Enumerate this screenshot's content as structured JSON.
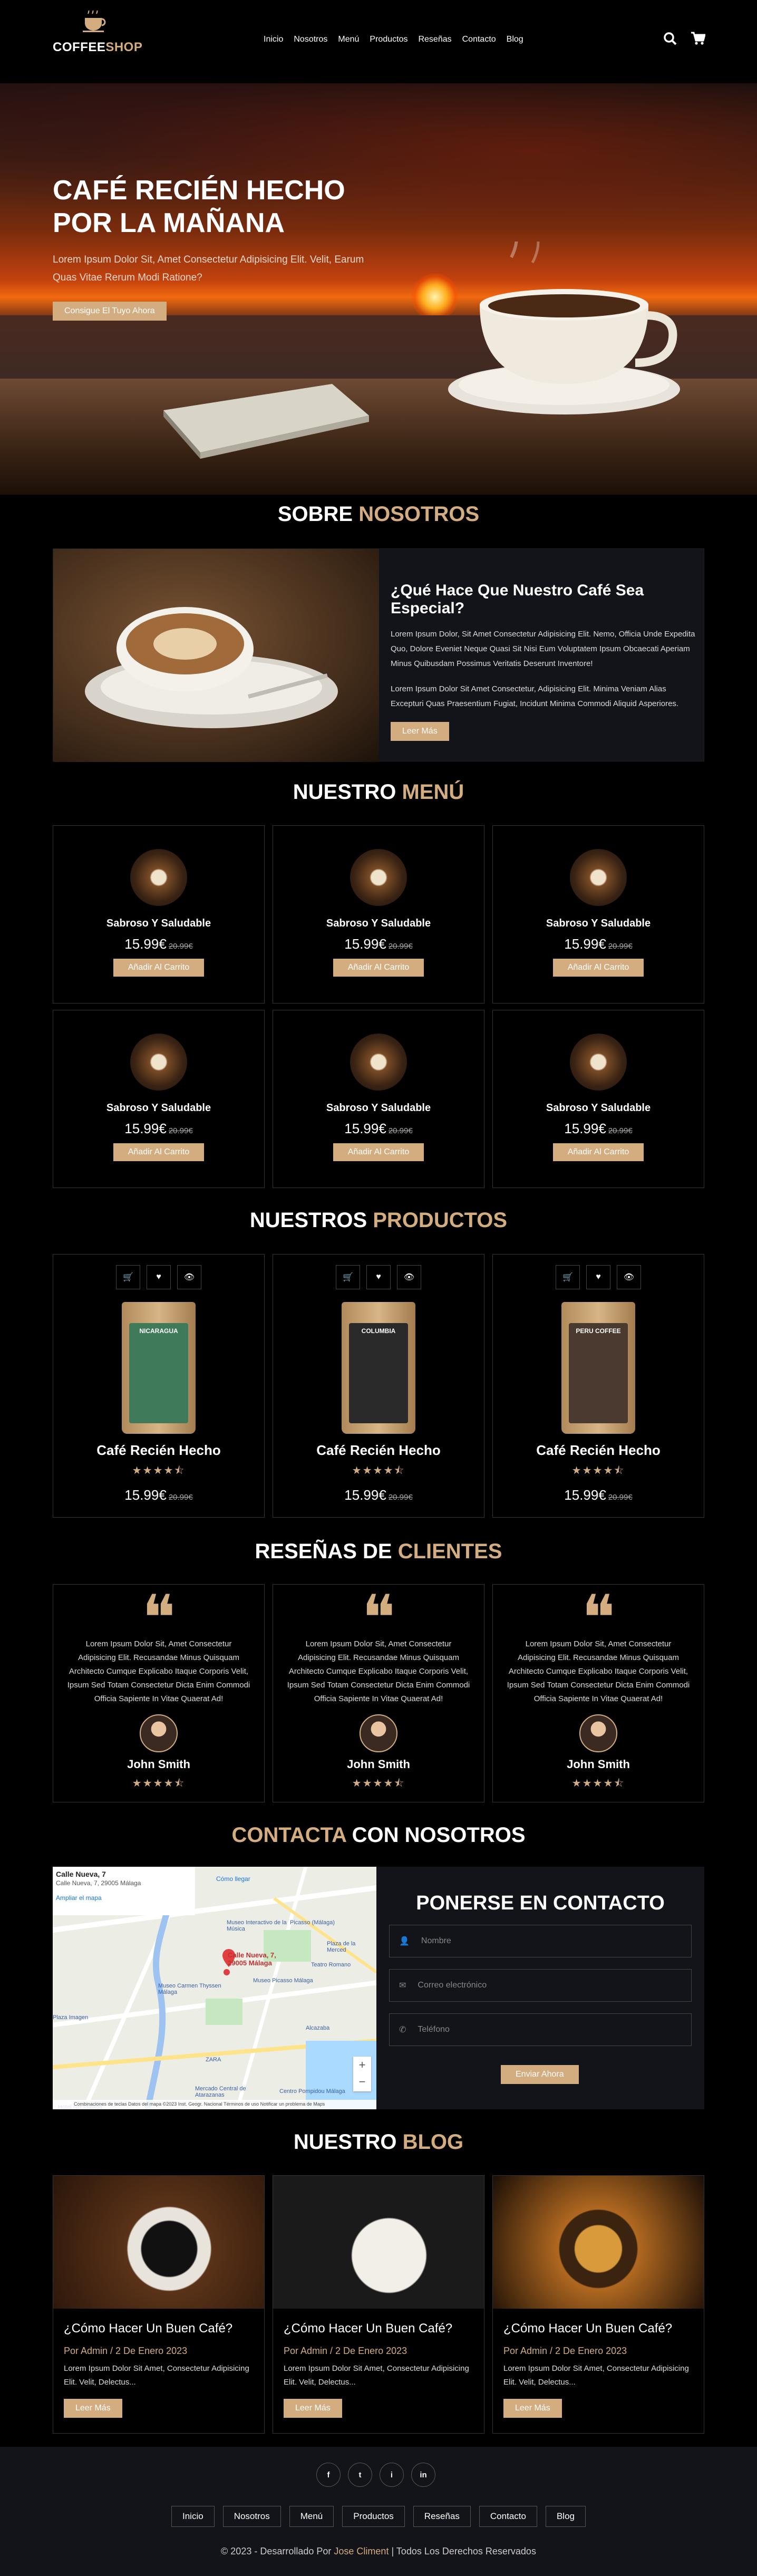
{
  "brand": {
    "part1": "COFFEE",
    "part2": "SHOP",
    "accent": "#d3ad7f"
  },
  "nav": [
    "Inicio",
    "Nosotros",
    "Menú",
    "Productos",
    "Reseñas",
    "Contacto",
    "Blog"
  ],
  "hero": {
    "title": "CAFÉ RECIÉN HECHO POR LA MAÑANA",
    "subtitle": "Lorem Ipsum Dolor Sit, Amet Consectetur Adipisicing Elit. Velit, Earum Quas Vitae Rerum Modi Ratione?",
    "button": "Consigue El Tuyo Ahora"
  },
  "about": {
    "title_a": "SOBRE ",
    "title_b": "NOSOTROS",
    "heading": "¿Qué Hace Que Nuestro Café Sea Especial?",
    "p1": "Lorem Ipsum Dolor, Sit Amet Consectetur Adipisicing Elit. Nemo, Officia Unde Expedita Quo, Dolore Eveniet Neque Quasi Sit Nisi Eum Voluptatem Ipsum Obcaecati Aperiam Minus Quibusdam Possimus Veritatis Deserunt Inventore!",
    "p2": "Lorem Ipsum Dolor Sit Amet Consectetur, Adipisicing Elit. Minima Veniam Alias Excepturi Quas Praesentium Fugiat, Incidunt Minima Commodi Aliquid Asperiores.",
    "button": "Leer Más"
  },
  "menu": {
    "title_a": "NUESTRO ",
    "title_b": "MENÚ",
    "items": [
      {
        "name": "Sabroso Y Saludable",
        "price": "15.99€",
        "old": "20.99€",
        "button": "Añadir Al Carrito"
      },
      {
        "name": "Sabroso Y Saludable",
        "price": "15.99€",
        "old": "20.99€",
        "button": "Añadir Al Carrito"
      },
      {
        "name": "Sabroso Y Saludable",
        "price": "15.99€",
        "old": "20.99€",
        "button": "Añadir Al Carrito"
      },
      {
        "name": "Sabroso Y Saludable",
        "price": "15.99€",
        "old": "20.99€",
        "button": "Añadir Al Carrito"
      },
      {
        "name": "Sabroso Y Saludable",
        "price": "15.99€",
        "old": "20.99€",
        "button": "Añadir Al Carrito"
      },
      {
        "name": "Sabroso Y Saludable",
        "price": "15.99€",
        "old": "20.99€",
        "button": "Añadir Al Carrito"
      }
    ]
  },
  "products": {
    "title_a": "NUESTROS ",
    "title_b": "PRODUCTOS",
    "items": [
      {
        "name": "Café Recién Hecho",
        "bag": "NICARAGUA",
        "bag_color": "#3f7a5a",
        "price": "15.99€",
        "old": "20.99€",
        "rating": 4.5
      },
      {
        "name": "Café Recién Hecho",
        "bag": "COLUMBIA",
        "bag_color": "#2a2a2a",
        "price": "15.99€",
        "old": "20.99€",
        "rating": 4.5
      },
      {
        "name": "Café Recién Hecho",
        "bag": "PERU COFFEE",
        "bag_color": "#4a3a30",
        "price": "15.99€",
        "old": "20.99€",
        "rating": 4.5
      }
    ]
  },
  "reviews": {
    "title_a": "RESEÑAS DE ",
    "title_b": "CLIENTES",
    "items": [
      {
        "text": "Lorem Ipsum Dolor Sit, Amet Consectetur Adipisicing Elit. Recusandae Minus Quisquam Architecto Cumque Explicabo Itaque Corporis Velit, Ipsum Sed Totam Consectetur Dicta Enim Commodi Officia Sapiente In Vitae Quaerat Ad!",
        "name": "John Smith",
        "rating": 4.5
      },
      {
        "text": "Lorem Ipsum Dolor Sit, Amet Consectetur Adipisicing Elit. Recusandae Minus Quisquam Architecto Cumque Explicabo Itaque Corporis Velit, Ipsum Sed Totam Consectetur Dicta Enim Commodi Officia Sapiente In Vitae Quaerat Ad!",
        "name": "John Smith",
        "rating": 4.5
      },
      {
        "text": "Lorem Ipsum Dolor Sit, Amet Consectetur Adipisicing Elit. Recusandae Minus Quisquam Architecto Cumque Explicabo Itaque Corporis Velit, Ipsum Sed Totam Consectetur Dicta Enim Commodi Officia Sapiente In Vitae Quaerat Ad!",
        "name": "John Smith",
        "rating": 4.5
      }
    ]
  },
  "contact": {
    "title_a": "CONTACTA ",
    "title_b": "CON NOSOTROS",
    "form_title": "PONERSE EN CONTACTO",
    "name_ph": "Nombre",
    "email_ph": "Correo electrónico",
    "phone_ph": "Teléfono",
    "button": "Enviar Ahora",
    "map": {
      "place": "Calle Nueva, 7",
      "address": "Calle Nueva, 7, 29005 Málaga",
      "directions": "Cómo llegar",
      "larger": "Ampliar el mapa",
      "pin": "Calle Nueva, 7, 29005 Málaga",
      "labels": [
        "Museo Interactivo de la Música",
        "Picasso (Málaga)",
        "Teatro Romano",
        "Plaza de la Merced",
        "Museo Picasso Málaga",
        "Museo Carmen Thyssen Málaga",
        "Alcazaba",
        "Plaza Imagen",
        "ZARA",
        "Mercado Central de Atarazanas",
        "Hotel NH Málaga",
        "Centro Pompidou Málaga",
        "Aduana",
        "Museo Málaga"
      ],
      "footer": "Combinaciones de teclas   Datos del mapa ©2023 Inst. Geogr. Nacional   Términos de uso   Notificar un problema de Maps"
    }
  },
  "blog": {
    "title_a": "NUESTRO ",
    "title_b": "BLOG",
    "items": [
      {
        "title": "¿Cómo Hacer Un Buen Café?",
        "meta": "Por Admin / 2 De Enero 2023",
        "text": "Lorem Ipsum Dolor Sit Amet, Consectetur Adipisicing Elit. Velit, Delectus...",
        "button": "Leer Más"
      },
      {
        "title": "¿Cómo Hacer Un Buen Café?",
        "meta": "Por Admin / 2 De Enero 2023",
        "text": "Lorem Ipsum Dolor Sit Amet, Consectetur Adipisicing Elit. Velit, Delectus...",
        "button": "Leer Más"
      },
      {
        "title": "¿Cómo Hacer Un Buen Café?",
        "meta": "Por Admin / 2 De Enero 2023",
        "text": "Lorem Ipsum Dolor Sit Amet, Consectetur Adipisicing Elit. Velit, Delectus...",
        "button": "Leer Más"
      }
    ]
  },
  "footer": {
    "social": [
      "f",
      "t",
      "i",
      "in"
    ],
    "social_icons": [
      "facebook-icon",
      "twitter-icon",
      "instagram-icon",
      "linkedin-icon"
    ],
    "nav": [
      "Inicio",
      "Nosotros",
      "Menú",
      "Productos",
      "Reseñas",
      "Contacto",
      "Blog"
    ],
    "credit_a": "© 2023 - Desarrollado Por ",
    "credit_name": "Jose Climent",
    "credit_b": " | Todos Los Derechos Reservados"
  }
}
